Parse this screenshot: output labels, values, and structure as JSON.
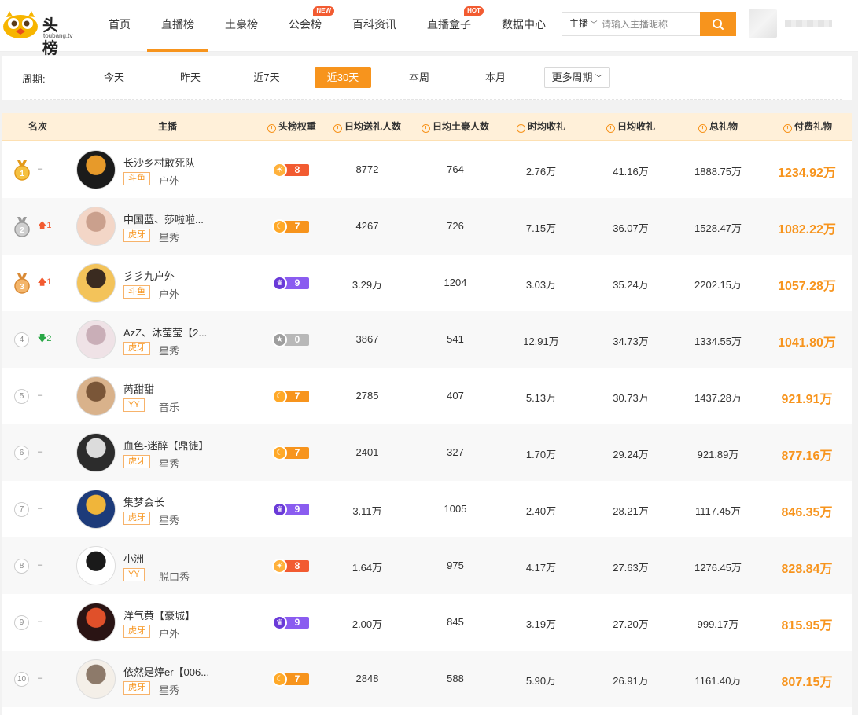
{
  "header": {
    "logo_text": "头榜",
    "logo_sub": "toubang.tv",
    "nav": [
      {
        "label": "首页",
        "badge": null
      },
      {
        "label": "直播榜",
        "badge": null,
        "active": true
      },
      {
        "label": "土豪榜",
        "badge": null
      },
      {
        "label": "公会榜",
        "badge": "NEW"
      },
      {
        "label": "百科资讯",
        "badge": null
      },
      {
        "label": "直播盒子",
        "badge": "HOT"
      },
      {
        "label": "数据中心",
        "badge": null
      }
    ],
    "search": {
      "type": "主播",
      "placeholder": "请输入主播昵称",
      "icon": "search-icon"
    }
  },
  "period": {
    "label": "周期:",
    "options": [
      "今天",
      "昨天",
      "近7天",
      "近30天",
      "本周",
      "本月"
    ],
    "active": "近30天",
    "more": "更多周期"
  },
  "table": {
    "headers": {
      "rank": "名次",
      "anchor": "主播",
      "weight": "头榜权重",
      "daily_givers": "日均送礼人数",
      "daily_tycoons": "日均土豪人数",
      "hourly": "时均收礼",
      "daily": "日均收礼",
      "total": "总礼物",
      "paid": "付费礼物"
    },
    "colors": {
      "accent": "#f7941d",
      "up": "#f25b31",
      "down": "#28a745",
      "header_bg": "#fff0d9"
    },
    "rows": [
      {
        "rank": "1",
        "change": "–",
        "trend": "same",
        "name": "长沙乡村敢死队",
        "platform": "斗鱼",
        "category": "户外",
        "weight": "8",
        "weight_tier": "sun",
        "daily_givers": "8772",
        "daily_tycoons": "764",
        "hourly": "2.76万",
        "daily": "41.16万",
        "total": "1888.75万",
        "paid": "1234.92万"
      },
      {
        "rank": "2",
        "change": "1",
        "trend": "up",
        "name": "中国蓝、莎啦啦...",
        "platform": "虎牙",
        "category": "星秀",
        "weight": "7",
        "weight_tier": "moon",
        "daily_givers": "4267",
        "daily_tycoons": "726",
        "hourly": "7.15万",
        "daily": "36.07万",
        "total": "1528.47万",
        "paid": "1082.22万"
      },
      {
        "rank": "3",
        "change": "1",
        "trend": "up",
        "name": "彡彡九户外",
        "platform": "斗鱼",
        "category": "户外",
        "weight": "9",
        "weight_tier": "crown",
        "daily_givers": "3.29万",
        "daily_tycoons": "1204",
        "hourly": "3.03万",
        "daily": "35.24万",
        "total": "2202.15万",
        "paid": "1057.28万"
      },
      {
        "rank": "4",
        "change": "2",
        "trend": "down",
        "name": "AzZ、沐莹莹【2...",
        "platform": "虎牙",
        "category": "星秀",
        "weight": "0",
        "weight_tier": "star",
        "daily_givers": "3867",
        "daily_tycoons": "541",
        "hourly": "12.91万",
        "daily": "34.73万",
        "total": "1334.55万",
        "paid": "1041.80万"
      },
      {
        "rank": "5",
        "change": "–",
        "trend": "same",
        "name": "芮甜甜",
        "platform": "YY",
        "category": "音乐",
        "weight": "7",
        "weight_tier": "moon",
        "daily_givers": "2785",
        "daily_tycoons": "407",
        "hourly": "5.13万",
        "daily": "30.73万",
        "total": "1437.28万",
        "paid": "921.91万"
      },
      {
        "rank": "6",
        "change": "–",
        "trend": "same",
        "name": "血色-迷醉【鼎徒】",
        "platform": "虎牙",
        "category": "星秀",
        "weight": "7",
        "weight_tier": "moon",
        "daily_givers": "2401",
        "daily_tycoons": "327",
        "hourly": "1.70万",
        "daily": "29.24万",
        "total": "921.89万",
        "paid": "877.16万"
      },
      {
        "rank": "7",
        "change": "–",
        "trend": "same",
        "name": "集梦会长",
        "platform": "虎牙",
        "category": "星秀",
        "weight": "9",
        "weight_tier": "crown",
        "daily_givers": "3.11万",
        "daily_tycoons": "1005",
        "hourly": "2.40万",
        "daily": "28.21万",
        "total": "1117.45万",
        "paid": "846.35万"
      },
      {
        "rank": "8",
        "change": "–",
        "trend": "same",
        "name": "小洲",
        "platform": "YY",
        "category": "脱口秀",
        "weight": "8",
        "weight_tier": "sun",
        "daily_givers": "1.64万",
        "daily_tycoons": "975",
        "hourly": "4.17万",
        "daily": "27.63万",
        "total": "1276.45万",
        "paid": "828.84万"
      },
      {
        "rank": "9",
        "change": "–",
        "trend": "same",
        "name": "洋气黄【豪城】",
        "platform": "虎牙",
        "category": "户外",
        "weight": "9",
        "weight_tier": "crown",
        "daily_givers": "2.00万",
        "daily_tycoons": "845",
        "hourly": "3.19万",
        "daily": "27.20万",
        "total": "999.17万",
        "paid": "815.95万"
      },
      {
        "rank": "10",
        "change": "–",
        "trend": "same",
        "name": "依然是婷er【006...",
        "platform": "虎牙",
        "category": "星秀",
        "weight": "7",
        "weight_tier": "moon",
        "daily_givers": "2848",
        "daily_tycoons": "588",
        "hourly": "5.90万",
        "daily": "26.91万",
        "total": "1161.40万",
        "paid": "807.15万"
      }
    ]
  }
}
